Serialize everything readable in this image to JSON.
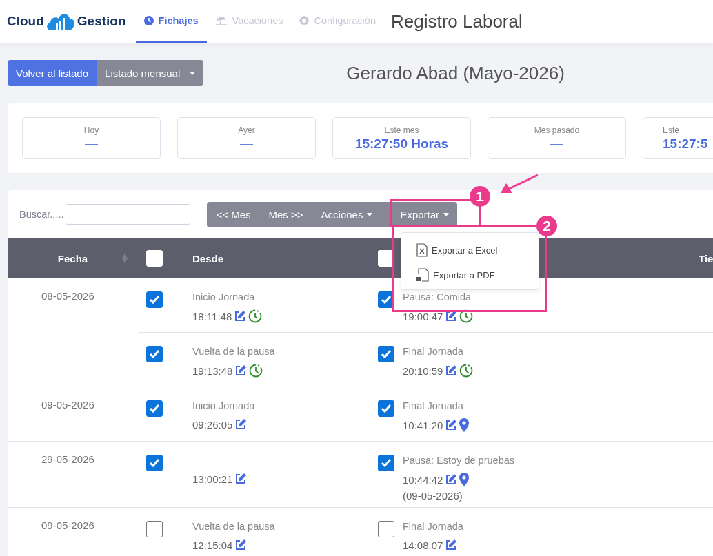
{
  "header": {
    "logo": {
      "left": "Cloud",
      "right": "Gestion"
    },
    "tabs": [
      {
        "label": "Fichajes",
        "selected": true
      },
      {
        "label": "Vacaciones",
        "selected": false
      },
      {
        "label": "Configuración",
        "selected": false
      }
    ],
    "title": "Registro Laboral"
  },
  "toolbar": {
    "back_button": "Volver al listado",
    "monthly_dropdown": "Listado mensual",
    "heading": "Gerardo Abad (Mayo-2026)"
  },
  "summary_cards": [
    {
      "label": "Hoy",
      "value": "—"
    },
    {
      "label": "Ayer",
      "value": "—"
    },
    {
      "label": "Este mes",
      "value": "15:27:50 Horas"
    },
    {
      "label": "Mes pasado",
      "value": "—"
    },
    {
      "label": "Este",
      "value": "15:27:5"
    }
  ],
  "records": {
    "search_label": "Buscar.....",
    "buttons": [
      {
        "label": "<< Mes",
        "dropdown": false
      },
      {
        "label": "Mes >>",
        "dropdown": false
      },
      {
        "label": "Acciones",
        "dropdown": true
      },
      {
        "label": "Exportar",
        "dropdown": true
      }
    ],
    "export_menu": [
      {
        "label": "Exportar a Excel"
      },
      {
        "label": "Exportar a PDF"
      }
    ],
    "table": {
      "columns": [
        {
          "kind": "text",
          "label": "Fecha",
          "sortable": true
        },
        {
          "kind": "check",
          "checked": false
        },
        {
          "kind": "text",
          "label": "Desde"
        },
        {
          "kind": "check",
          "checked": false
        },
        {
          "kind": "spacer"
        },
        {
          "kind": "text",
          "label": "Tie"
        }
      ],
      "rows": [
        {
          "date": "08-05-2026",
          "entries": [
            {
              "start": {
                "checked": true,
                "label": "Inicio Jornada",
                "time": "18:11:48",
                "scheduled": true
              },
              "end": {
                "checked": true,
                "label": "Pausa: Comida",
                "time": "19:00:47",
                "scheduled": true
              }
            },
            {
              "start": {
                "checked": true,
                "label": "Vuelta de la pausa",
                "time": "19:13:48",
                "scheduled": true
              },
              "end": {
                "checked": true,
                "label": "Final Jornada",
                "time": "20:10:59",
                "scheduled": true
              }
            }
          ]
        },
        {
          "date": "09-05-2026",
          "entries": [
            {
              "start": {
                "checked": true,
                "label": "Inicio Jornada",
                "time": "09:26:05"
              },
              "end": {
                "checked": true,
                "label": "Final Jornada",
                "time": "10:41:20",
                "geolocated": true
              }
            }
          ]
        },
        {
          "date": "29-05-2026",
          "entries": [
            {
              "start": {
                "checked": true,
                "time": "13:00:21"
              },
              "end": {
                "checked": true,
                "label": "Pausa: Estoy de pruebas",
                "time": "10:44:42",
                "geolocated": true,
                "note": "(09-05-2026)"
              }
            }
          ]
        },
        {
          "date": "09-05-2026",
          "entries": [
            {
              "start": {
                "checked": false,
                "label": "Vuelta de la pausa",
                "time": "12:15:04"
              },
              "end": {
                "checked": false,
                "label": "Final Jornada",
                "time": "14:08:07"
              }
            }
          ]
        }
      ]
    }
  },
  "annotations": [
    {
      "number": "1"
    },
    {
      "number": "2"
    }
  ]
}
